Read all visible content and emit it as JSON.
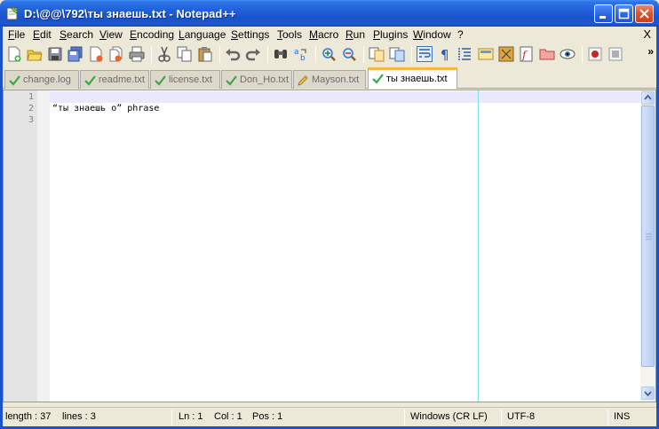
{
  "window": {
    "title": "D:\\@@\\792\\ты знаешь.txt - Notepad++"
  },
  "menu": {
    "items": [
      "File",
      "Edit",
      "Search",
      "View",
      "Encoding",
      "Language",
      "Settings",
      "Tools",
      "Macro",
      "Run",
      "Plugins",
      "Window",
      "?"
    ],
    "close_label": "X"
  },
  "toolbar": {
    "icons": [
      "new-file",
      "open-file",
      "save",
      "save-all",
      "close",
      "close-all",
      "print",
      "cut",
      "copy",
      "paste",
      "undo",
      "redo",
      "find",
      "replace",
      "zoom-in",
      "zoom-out",
      "sync-vertical",
      "sync-horizontal",
      "word-wrap",
      "show-all-chars",
      "indent-guide",
      "user-defined-language",
      "doc-map",
      "function-list",
      "folder-as-workspace",
      "monitoring",
      "record-macro",
      "stop-macro"
    ],
    "overflow_label": "»"
  },
  "tabs": [
    {
      "label": "change.log",
      "state": "saved"
    },
    {
      "label": "readme.txt",
      "state": "saved"
    },
    {
      "label": "license.txt",
      "state": "saved"
    },
    {
      "label": "Don_Ho.txt",
      "state": "saved"
    },
    {
      "label": "Mayson.txt",
      "state": "edited"
    },
    {
      "label": "ты знаешь.txt",
      "state": "saved",
      "active": true
    }
  ],
  "editor": {
    "lines": [
      {
        "number": "1",
        "text": ""
      },
      {
        "number": "2",
        "text": "“ты знаешь о” phrase"
      },
      {
        "number": "3",
        "text": ""
      }
    ],
    "current_line": 1
  },
  "status": {
    "length": "length : 37",
    "lines": "lines : 3",
    "ln": "Ln : 1",
    "col": "Col : 1",
    "pos": "Pos : 1",
    "eol": "Windows (CR LF)",
    "encoding": "UTF-8",
    "mode": "INS"
  },
  "colors": {
    "titlebar": "#1f5fd8",
    "active_tab_accent": "#fab63c",
    "current_line": "#e8e8ff",
    "edge_line": "#80e0e8",
    "saved_tab_icon": "#3aa845"
  }
}
